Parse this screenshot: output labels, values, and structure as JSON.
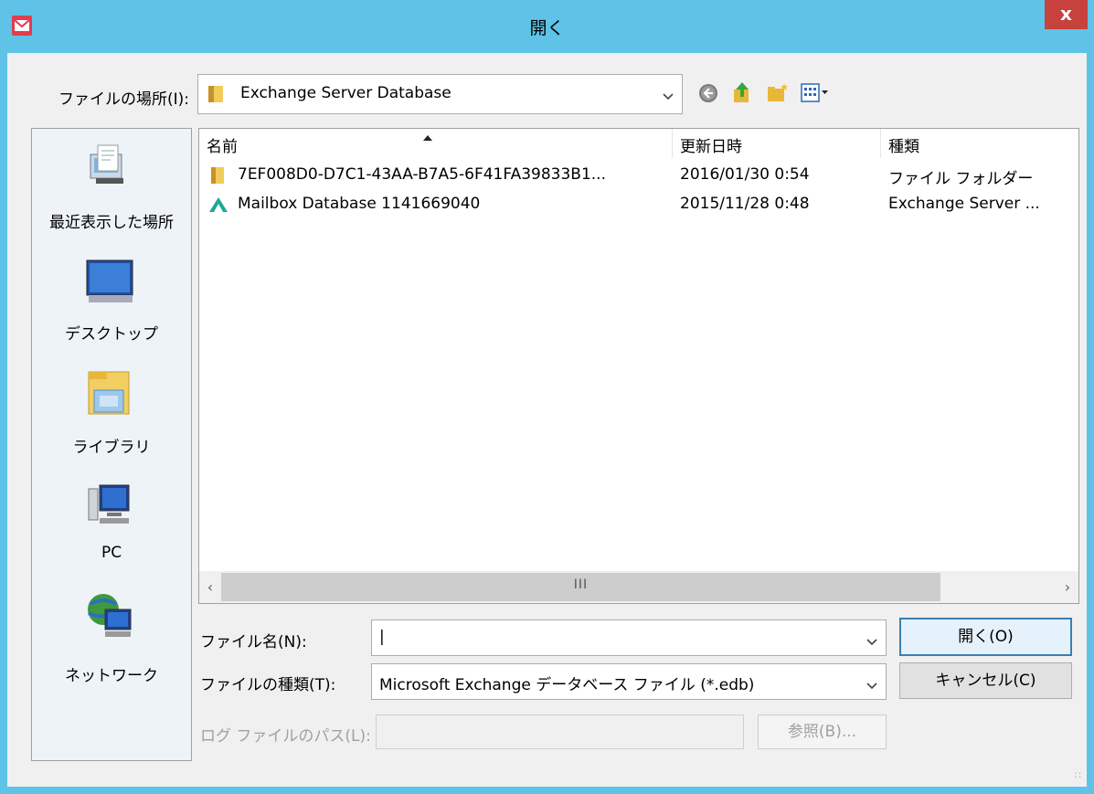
{
  "window": {
    "title": "開く",
    "close_label": "x"
  },
  "lookin": {
    "label": "ファイルの場所(I):",
    "value": "Exchange Server Database"
  },
  "places": [
    {
      "label": "最近表示した場所",
      "icon": "recent-places-icon"
    },
    {
      "label": "デスクトップ",
      "icon": "desktop-icon"
    },
    {
      "label": "ライブラリ",
      "icon": "libraries-icon"
    },
    {
      "label": "PC",
      "icon": "computer-icon"
    },
    {
      "label": "ネットワーク",
      "icon": "network-icon"
    }
  ],
  "columns": {
    "name": "名前",
    "modified": "更新日時",
    "type": "種類"
  },
  "files": [
    {
      "name": "7EF008D0-D7C1-43AA-B7A5-6F41FA39833B1...",
      "modified": "2016/01/30 0:54",
      "type": "ファイル フォルダー",
      "icon": "folder-icon"
    },
    {
      "name": "Mailbox Database 1141669040",
      "modified": "2015/11/28 0:48",
      "type": "Exchange Server ...",
      "icon": "exchange-db-icon"
    }
  ],
  "filename": {
    "label": "ファイル名(N):",
    "value": "|"
  },
  "filetype": {
    "label": "ファイルの種類(T):",
    "value": "Microsoft Exchange データベース ファイル (*.edb)"
  },
  "logpath": {
    "label": "ログ ファイルのパス(L):",
    "value": ""
  },
  "buttons": {
    "open": "開く(O)",
    "cancel": "キャンセル(C)",
    "browse": "参照(B)..."
  },
  "scrollbar": {
    "thumb_grip": "III"
  },
  "colors": {
    "titlebar": "#5ec3e6",
    "close": "#c7423c",
    "accent": "#3c7fb1"
  }
}
